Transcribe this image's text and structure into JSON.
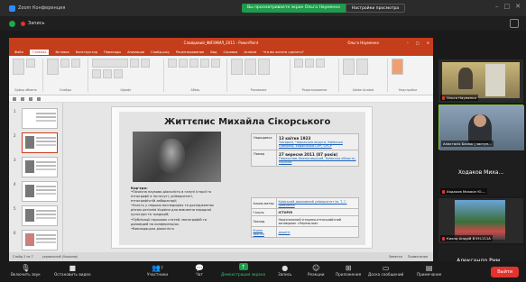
{
  "zoom": {
    "window_title": "Zoom Конференция",
    "share_banner": "Вы просматриваете экран Ольга Науменко",
    "view_options": "Настройки просмотра",
    "recording_label": "Запись"
  },
  "ppt": {
    "title": "Слайдовий_ФИЗЖИЛ_2011 - PowerPoint",
    "user": "Ольга Науменко",
    "tabs": [
      "Файл",
      "Главная",
      "Вставка",
      "Конструктор",
      "Переходы",
      "Анимация",
      "Слайд-шоу",
      "Рецензирование",
      "Вид",
      "Справка",
      "Acrobat",
      "Что вы хотите сделать?"
    ],
    "groups": [
      "Буфер обмена",
      "Слайды",
      "Шрифт",
      "Абзац",
      "Рисование",
      "Редактирование",
      "Adobe Acrobat",
      "Надстройки"
    ],
    "status_left": "Слайд 2 из 7",
    "status_lang": "украинский (Украина)",
    "status_right": [
      "Заметки",
      "Примечания"
    ],
    "thumb_numbers": [
      "1",
      "2",
      "3",
      "4",
      "5",
      "6"
    ]
  },
  "slide": {
    "title": "Життєпис Михайла Сікорського",
    "bio_heading": "Кар'єра:",
    "bio_lines": [
      "•Почесна наукова діяльність в галузі історії та",
      "етнографії в інституті, університеті,",
      "етнографічній лабораторії;",
      "•Участь у перших експедиціях та дослідженнях",
      "різних регіонів України для вивчення народної",
      "культури та традицій;",
      "•Публікації наукових статей, монографій та",
      "доповідей на конференціях.",
      "•Викладацька діяльність"
    ],
    "born_label": "Народився",
    "born_date": "13 квітня 1923",
    "born_place": "Чигирин, Черкаська округа, Київська губернія, Українська СРР, СРСР",
    "died_label": "Помер",
    "died_date": "27 вересня 2011 (87 років)",
    "died_place": "Переяслав-Хмельницький, Київська область, Україна",
    "alma_mater_label": "Альма-матер",
    "alma_mater": "Київський державний університет ім. Т. Г. Шевченка",
    "field_label": "Галузь",
    "field": "ІСТОРІЯ",
    "institution_label": "Заклад",
    "institution": "Національний історико-етнографічний заповідник «Переяслав»",
    "degree_label": "Вчене звання",
    "degree": "доцент"
  },
  "participants": {
    "tile1_name": "Ольга Науменко",
    "tile2_name": "Анастасія Басюк | заступ...",
    "tile3_big": "Ходаков Миха...",
    "tile3_name": "Ходаков Михаил Ю-...",
    "tile4_name": "Киянд Андрій В ЕН-111А",
    "tile5_big": "Александр Рим...",
    "tile5_name": "Александр Римский |..."
  },
  "toolbar": {
    "mute": "Включить звук",
    "video": "Остановить видео",
    "participants": "Участники",
    "participants_count": "7",
    "chat": "Чат",
    "share": "Демонстрация экрана",
    "record": "Запись",
    "reactions": "Реакции",
    "apps": "Приложения",
    "whiteboard": "Доска сообщений",
    "notes": "Примечание",
    "leave": "Выйти"
  }
}
